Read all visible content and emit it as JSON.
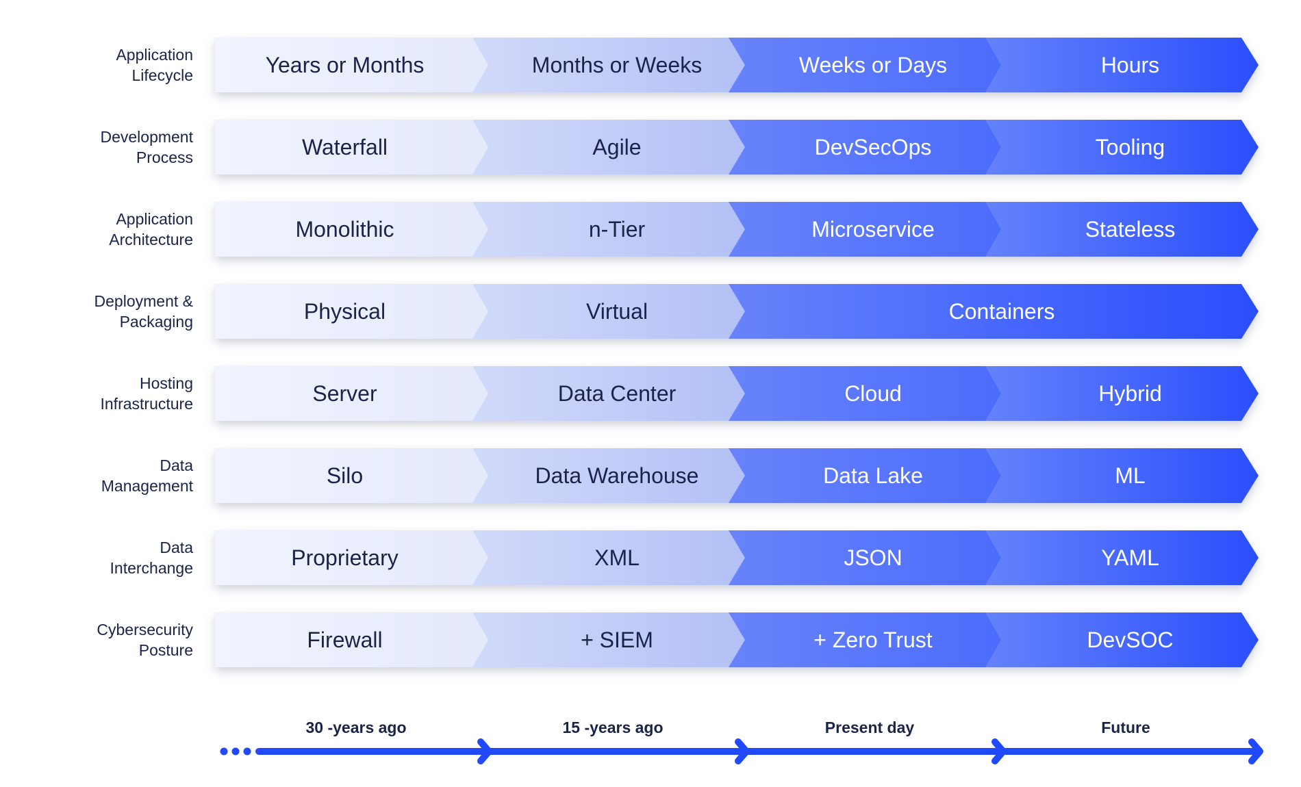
{
  "colors": {
    "text_dark": "#1B2348",
    "text_light": "#FFFFFF",
    "timeline_blue": "#2149FF",
    "stage_1": "#EEF1FC",
    "stage_2": "#C4CEF8",
    "stage_3": "#5C78FB",
    "stage_4": "#2C50FC"
  },
  "rows": [
    {
      "label_line1": "Application",
      "label_line2": "Lifecycle",
      "stages": [
        "Years or Months",
        "Months or Weeks",
        "Weeks or Days",
        "Hours"
      ]
    },
    {
      "label_line1": "Development",
      "label_line2": "Process",
      "stages": [
        "Waterfall",
        "Agile",
        "DevSecOps",
        "Tooling"
      ]
    },
    {
      "label_line1": "Application",
      "label_line2": "Architecture",
      "stages": [
        "Monolithic",
        "n-Tier",
        "Microservice",
        "Stateless"
      ]
    },
    {
      "label_line1": "Deployment &",
      "label_line2": "Packaging",
      "stages": [
        "Physical",
        "Virtual",
        "Containers"
      ],
      "merged_last": true
    },
    {
      "label_line1": "Hosting",
      "label_line2": "Infrastructure",
      "stages": [
        "Server",
        "Data Center",
        "Cloud",
        "Hybrid"
      ]
    },
    {
      "label_line1": "Data",
      "label_line2": "Management",
      "stages": [
        "Silo",
        "Data Warehouse",
        "Data Lake",
        "ML"
      ]
    },
    {
      "label_line1": "Data",
      "label_line2": "Interchange",
      "stages": [
        "Proprietary",
        "XML",
        "JSON",
        "YAML"
      ]
    },
    {
      "label_line1": "Cybersecurity",
      "label_line2": "Posture",
      "stages": [
        "Firewall",
        "+ SIEM",
        "+ Zero Trust",
        "DevSOC"
      ]
    }
  ],
  "timeline": {
    "labels": [
      "30 -years ago",
      "15 -years ago",
      "Present day",
      "Future"
    ]
  }
}
